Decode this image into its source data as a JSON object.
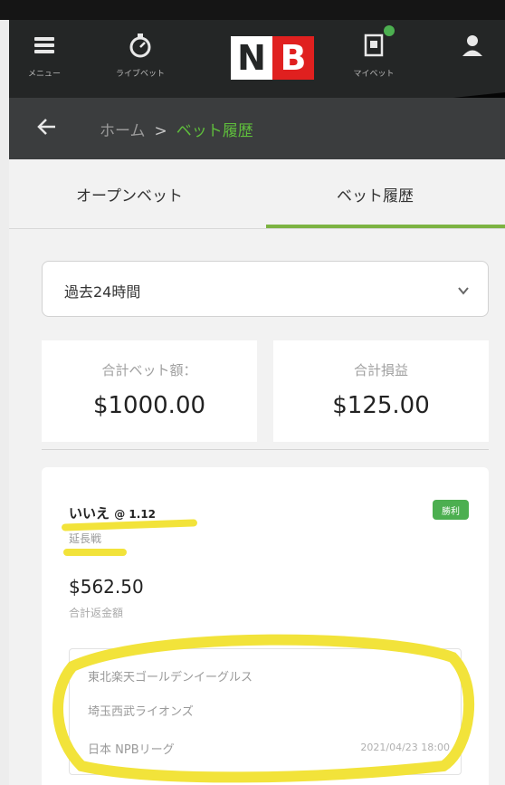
{
  "nav": {
    "menu_label": "メニュー",
    "live_label": "ライブベット",
    "logo_left": "N",
    "logo_right": "B",
    "mybet_label": "マイベット"
  },
  "breadcrumb": {
    "home": "ホーム",
    "separator": ">",
    "current": "ベット履歴"
  },
  "tabs": [
    {
      "label": "オープンベット",
      "active": false
    },
    {
      "label": "ベット履歴",
      "active": true
    }
  ],
  "filter": {
    "value": "過去24時間"
  },
  "stats": [
    {
      "label": "合計ベット額：",
      "value": "$1000.00"
    },
    {
      "label": "合計損益",
      "value": "$125.00"
    }
  ],
  "bet_card": {
    "selection": "いいえ",
    "odds": "@ 1.12",
    "bet_type": "延長戦",
    "status": "勝利",
    "amount": "$562.50",
    "amount_label": "合計返金額",
    "event": {
      "match": "東北楽天ゴールデンイーグルス",
      "opponent": "埼玉西武ライオンズ",
      "league": "日本 NPBリーグ",
      "datetime": "2021/04/23 18:00"
    }
  },
  "colors": {
    "navbar": "#242626",
    "subbar": "#3b3d3e",
    "accent_green": "#5fbe3c",
    "tab_underline": "#7cb342",
    "brand_red": "#e0201f",
    "highlight_yellow": "#f2e33a"
  }
}
